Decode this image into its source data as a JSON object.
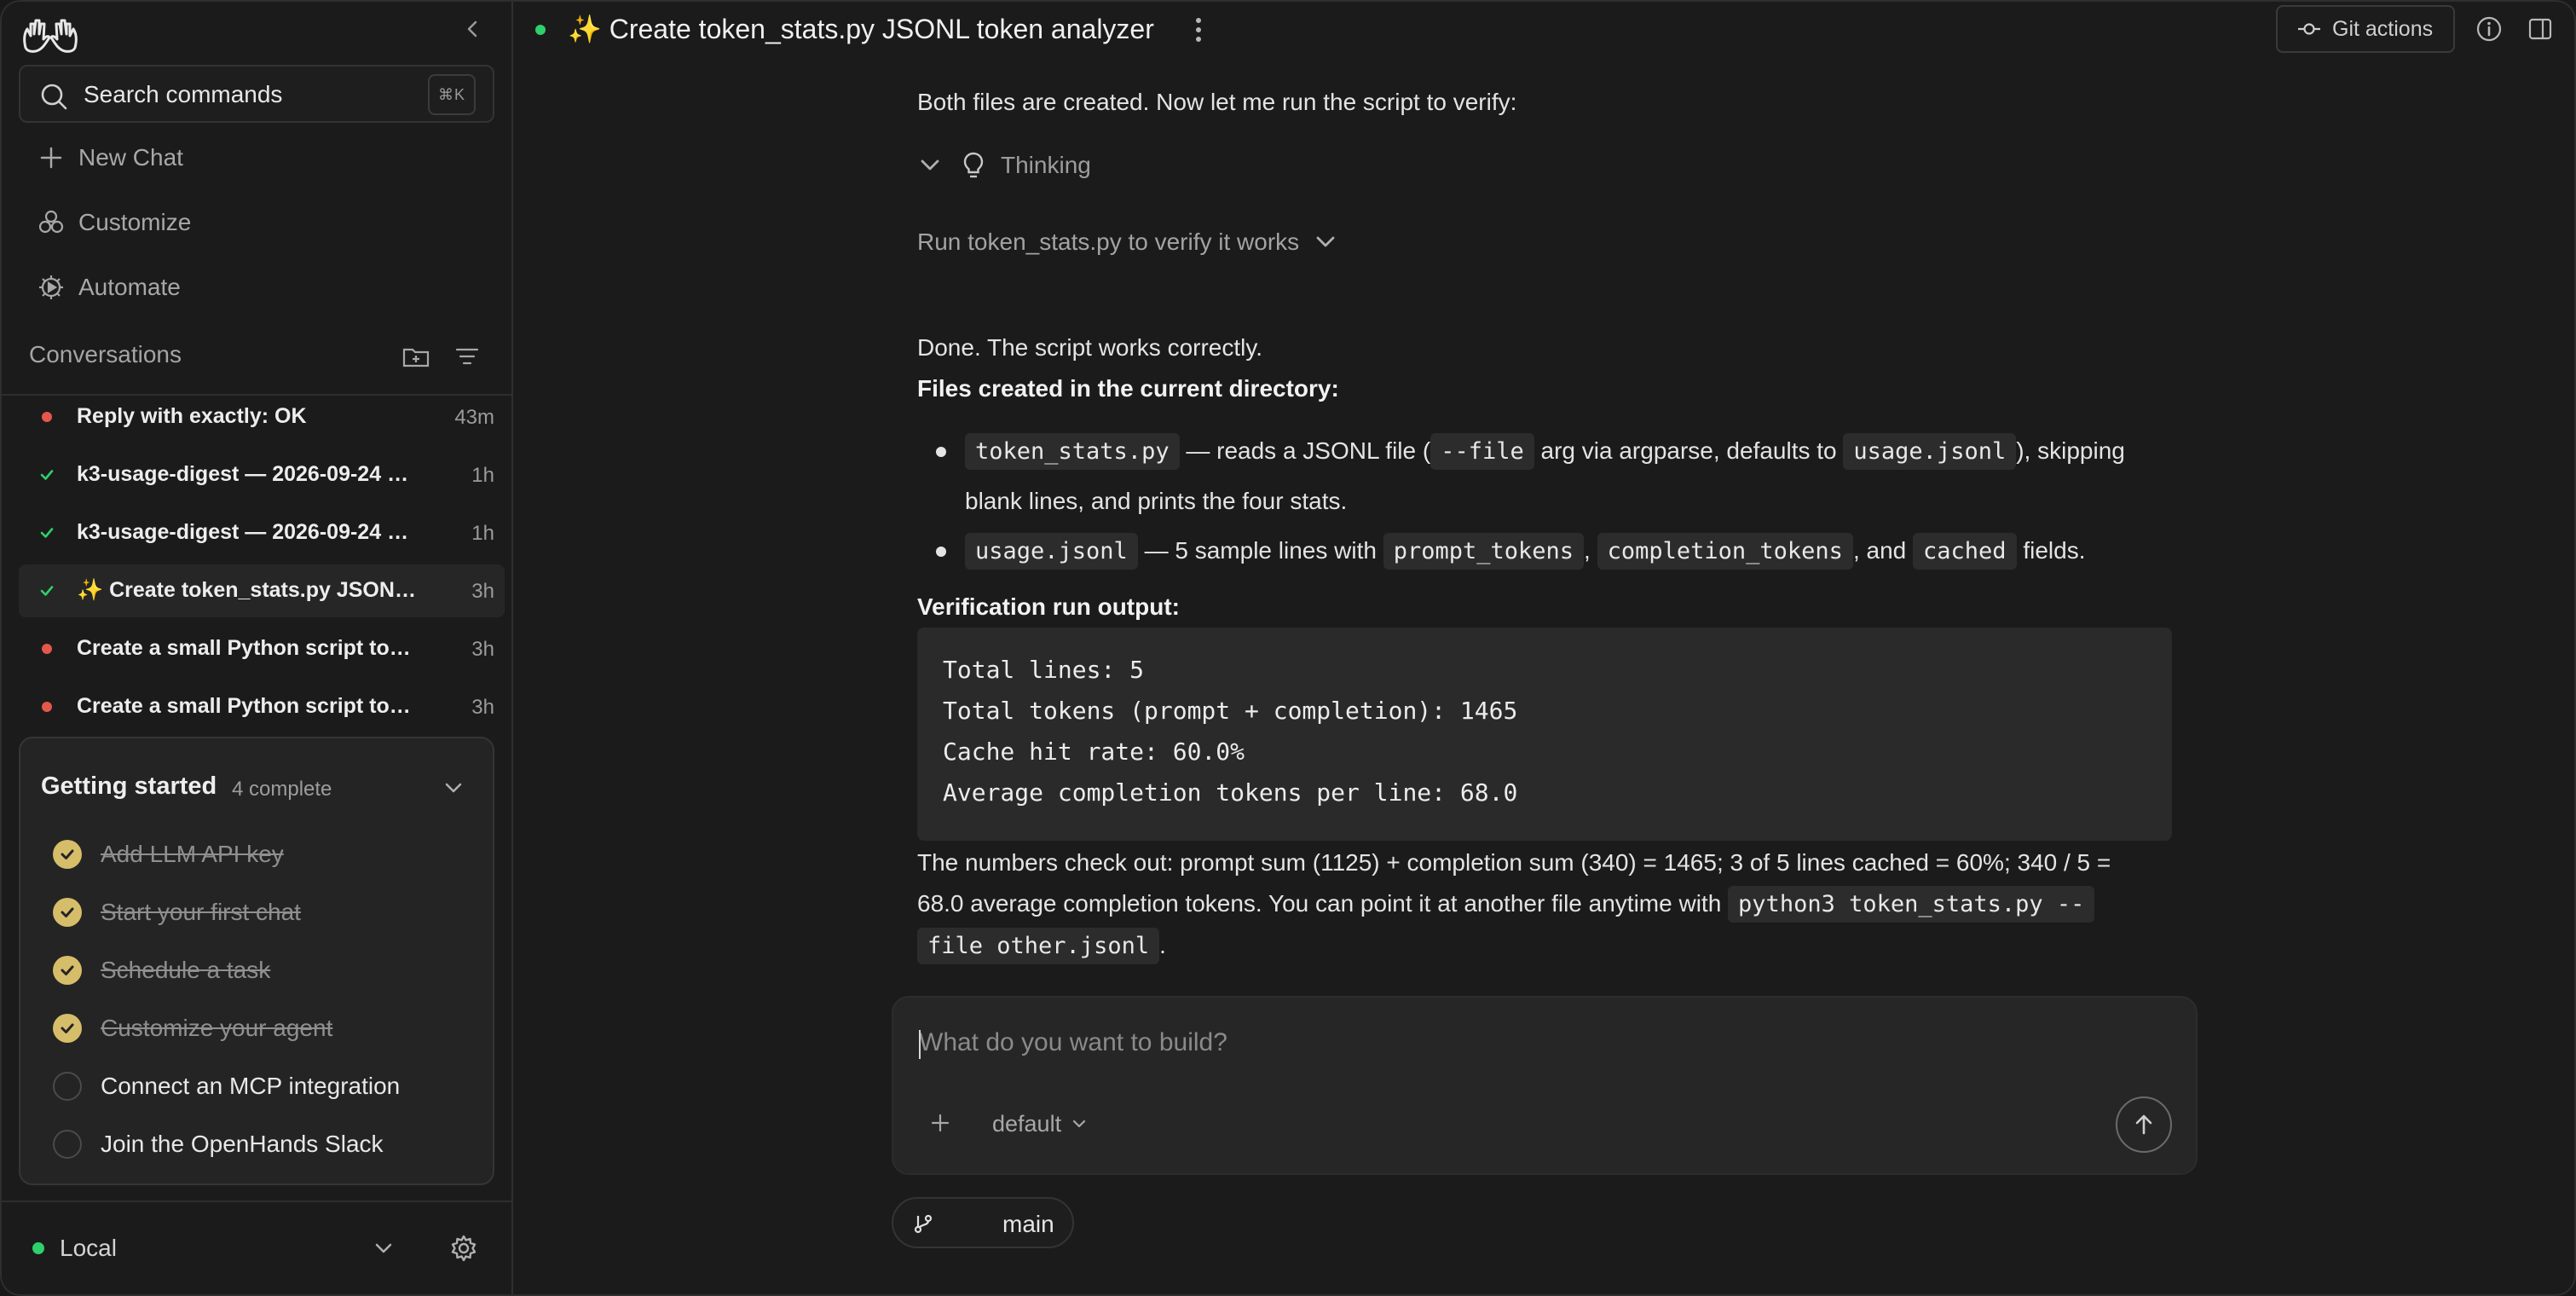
{
  "sidebar": {
    "search": {
      "label": "Search commands",
      "shortcut": "⌘K"
    },
    "nav": [
      {
        "label": "New Chat",
        "icon": "plus-icon"
      },
      {
        "label": "Customize",
        "icon": "customize-icon"
      },
      {
        "label": "Automate",
        "icon": "automate-icon"
      }
    ],
    "conversations_label": "Conversations",
    "conversations": [
      {
        "title": "Reply with exactly: OK",
        "time": "43m",
        "status": "error"
      },
      {
        "title": "k3-usage-digest — 2026-09-24 16:2...",
        "time": "1h",
        "status": "done"
      },
      {
        "title": "k3-usage-digest — 2026-09-24 16:1...",
        "time": "1h",
        "status": "done"
      },
      {
        "title": "✨ Create token_stats.py JSONL tok...",
        "time": "3h",
        "status": "done",
        "active": true
      },
      {
        "title": "Create a small Python script token_s...",
        "time": "3h",
        "status": "error"
      },
      {
        "title": "Create a small Python script token_s...",
        "time": "3h",
        "status": "error"
      }
    ],
    "getting_started": {
      "title": "Getting started",
      "count": "4 complete",
      "tasks": [
        {
          "label": "Add LLM API key",
          "done": true
        },
        {
          "label": "Start your first chat",
          "done": true
        },
        {
          "label": "Schedule a task",
          "done": true
        },
        {
          "label": "Customize your agent",
          "done": true
        },
        {
          "label": "Connect an MCP integration",
          "done": false
        },
        {
          "label": "Join the OpenHands Slack",
          "done": false
        }
      ]
    },
    "environment": "Local"
  },
  "topbar": {
    "title": "✨ Create token_stats.py JSONL token analyzer",
    "git_label": "Git actions"
  },
  "chat": {
    "intro": "Both files are created. Now let me run the script to verify:",
    "thinking": "Thinking",
    "run_step": "Run token_stats.py to verify it works",
    "done": "Done. The script works correctly.",
    "files_heading": "Files created in the current directory:",
    "bullet1": {
      "code1": "token_stats.py",
      "t1": " — reads a JSONL file (",
      "code2": "--file",
      "t2": " arg via argparse, defaults to ",
      "code3": "usage.jsonl",
      "t3": "), skipping",
      "t4": "blank lines, and prints the four stats."
    },
    "bullet2": {
      "code1": "usage.jsonl",
      "t1": " — 5 sample lines with ",
      "code2": "prompt_tokens",
      "t2": ", ",
      "code3": "completion_tokens",
      "t3": ", and ",
      "code4": "cached",
      "t4": " fields."
    },
    "verify_heading": "Verification run output:",
    "output_lines": [
      "Total lines: 5",
      "Total tokens (prompt + completion): 1465",
      "Cache hit rate: 60.0%",
      "Average completion tokens per line: 68.0"
    ],
    "summary1": "The numbers check out: prompt sum (1125) + completion sum (340) = 1465; 3 of 5 lines cached = 60%; 340 / 5 =",
    "summary2": "68.0 average completion tokens. You can point it at another file anytime with ",
    "summary_code1": "python3 token_stats.py --",
    "summary_code2": "file other.jsonl",
    "summary_end": "."
  },
  "composer": {
    "placeholder": "What do you want to build?",
    "model": "default",
    "branch": "main"
  },
  "colors": {
    "accent_green": "#2fcf6b",
    "error_red": "#e5574b",
    "check_gold": "#d6bd6a"
  }
}
